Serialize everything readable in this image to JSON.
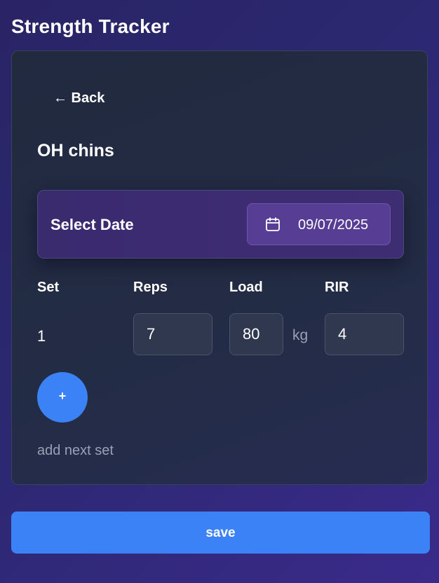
{
  "app": {
    "title": "Strength Tracker"
  },
  "nav": {
    "back_label": "← Back"
  },
  "exercise": {
    "name": "OH chins"
  },
  "date_picker": {
    "label": "Select Date",
    "value": "09/07/2025",
    "icon": "calendar-icon"
  },
  "table": {
    "headers": {
      "set": "Set",
      "reps": "Reps",
      "load": "Load",
      "rir": "RIR"
    },
    "rows": [
      {
        "set": "1",
        "reps": "7",
        "load": "80",
        "unit": "kg",
        "rir": "4"
      }
    ]
  },
  "add_set": {
    "button_label": "+",
    "caption": "add next set"
  },
  "actions": {
    "save_label": "save"
  },
  "colors": {
    "accent": "#3b82f6",
    "date_button": "#573d94",
    "card_background": "#222b42"
  }
}
